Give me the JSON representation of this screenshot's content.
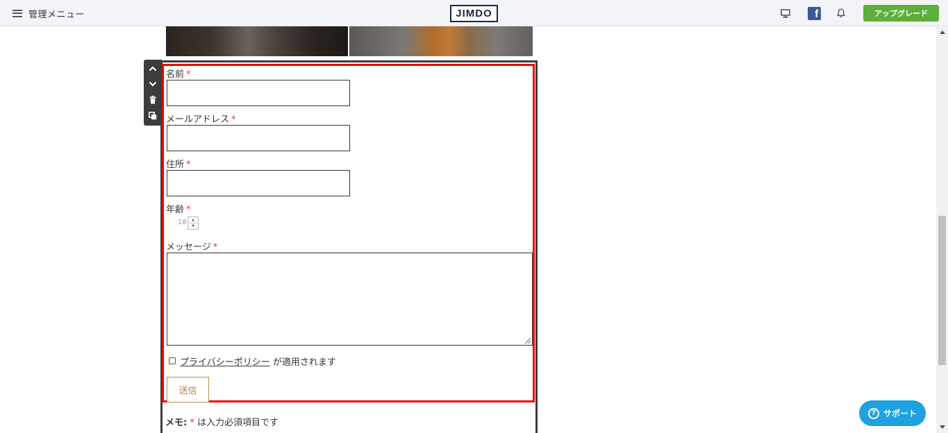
{
  "topbar": {
    "menu_label": "管理メニュー",
    "logo_text": "JIMDO",
    "facebook_letter": "f",
    "upgrade_label": "アップグレード",
    "accent_color": "#5fae3c"
  },
  "form": {
    "fields": [
      {
        "label": "名前",
        "required_mark": "*"
      },
      {
        "label": "メールアドレス",
        "required_mark": "*"
      },
      {
        "label": "住所",
        "required_mark": "*"
      },
      {
        "label": "年齢",
        "required_mark": "*",
        "value": "18"
      },
      {
        "label": "メッセージ",
        "required_mark": "*"
      }
    ],
    "privacy_link": "プライバシーポリシー",
    "privacy_suffix": " が適用されます",
    "submit_label": "送信",
    "memo_prefix": "メモ:",
    "memo_mark": "*",
    "memo_suffix": " は入力必須項目です",
    "required_color": "#e1362c",
    "highlight_color": "#ee0000"
  },
  "support": {
    "icon_glyph": "?",
    "label": "サポート",
    "color": "#1ea2e0"
  }
}
